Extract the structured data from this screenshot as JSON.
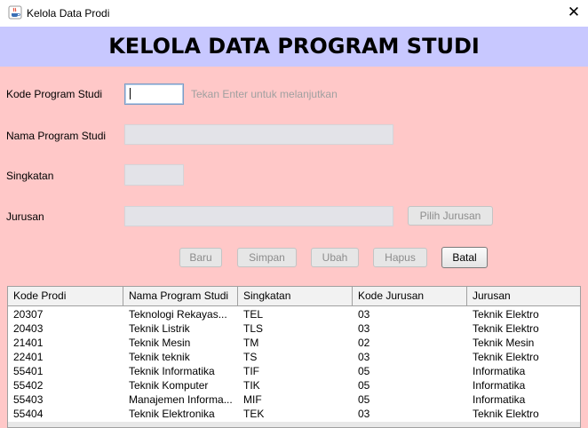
{
  "window": {
    "title": "Kelola Data Prodi",
    "app_icon": "java-cup-icon",
    "close_icon": "close-icon",
    "close_glyph": "✕"
  },
  "header": {
    "title": "KELOLA DATA PROGRAM STUDI"
  },
  "form": {
    "kode": {
      "label": "Kode Program Studi",
      "value": "",
      "hint": "Tekan Enter untuk melanjutkan"
    },
    "nama": {
      "label": "Nama Program Studi",
      "value": ""
    },
    "singkatan": {
      "label": "Singkatan",
      "value": ""
    },
    "jurusan": {
      "label": "Jurusan",
      "value": "",
      "button": "Pilih Jurusan"
    }
  },
  "actions": {
    "baru": "Baru",
    "simpan": "Simpan",
    "ubah": "Ubah",
    "hapus": "Hapus",
    "batal": "Batal"
  },
  "table": {
    "columns": [
      "Kode Prodi",
      "Nama Program Studi",
      "Singkatan",
      "Kode Jurusan",
      "Jurusan"
    ],
    "rows": [
      [
        "20307",
        "Teknologi Rekayas...",
        "TEL",
        "03",
        "Teknik Elektro"
      ],
      [
        "20403",
        "Teknik Listrik",
        "TLS",
        "03",
        "Teknik Elektro"
      ],
      [
        "21401",
        "Teknik Mesin",
        "TM",
        "02",
        "Teknik Mesin"
      ],
      [
        "22401",
        "Teknik teknik",
        "TS",
        "03",
        "Teknik Elektro"
      ],
      [
        "55401",
        "Teknik Informatika",
        "TIF",
        "05",
        "Informatika"
      ],
      [
        "55402",
        "Teknik Komputer",
        "TIK",
        "05",
        "Informatika"
      ],
      [
        "55403",
        "Manajemen Informa...",
        "MIF",
        "05",
        "Informatika"
      ],
      [
        "55404",
        "Teknik Elektronika",
        "TEK",
        "03",
        "Teknik Elektro"
      ]
    ]
  },
  "colors": {
    "header_bg": "#c8c8ff",
    "form_bg": "#ffc8c8",
    "disabled_field": "#e3e3e8"
  }
}
